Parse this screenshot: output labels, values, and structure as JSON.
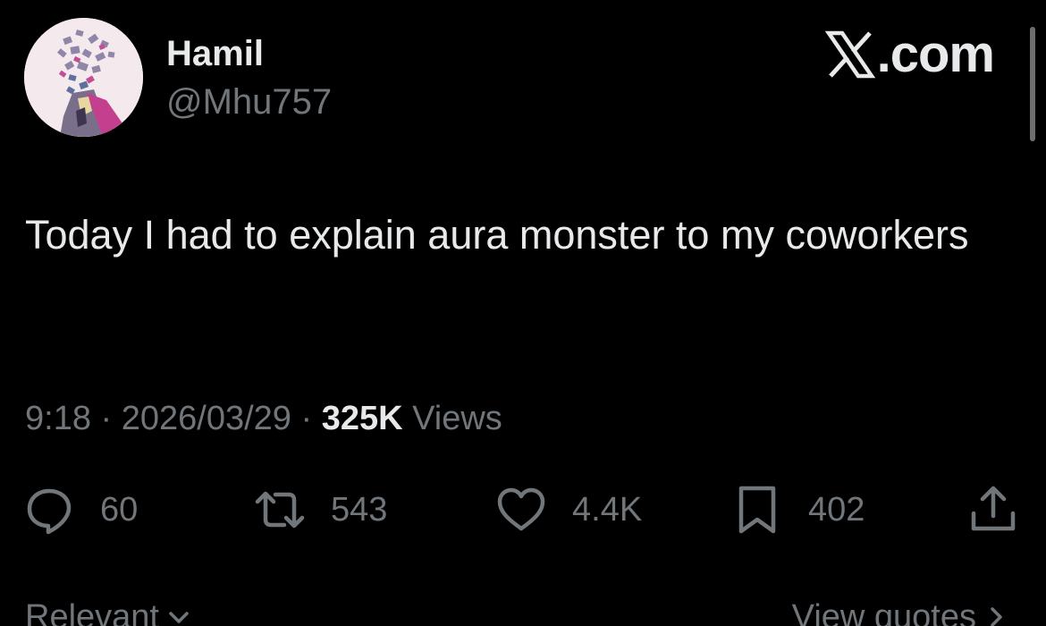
{
  "colors": {
    "background": "#000000",
    "primary_text": "#e7e9ea",
    "secondary_text": "#71767b"
  },
  "author": {
    "display_name": "Hamil",
    "handle": "@Mhu757",
    "avatar_icon": "avatar-illustration"
  },
  "brand": {
    "label": ".com",
    "icon": "x-logo-icon"
  },
  "post": {
    "text": "Today I had to explain aura monster to my coworkers"
  },
  "meta": {
    "time": "9:18",
    "separator": " · ",
    "date": "2026/03/29",
    "views_count": "325K",
    "views_label": " Views"
  },
  "actions": {
    "reply": {
      "icon": "reply-icon",
      "count": "60"
    },
    "repost": {
      "icon": "repost-icon",
      "count": "543"
    },
    "like": {
      "icon": "heart-icon",
      "count": "4.4K"
    },
    "bookmark": {
      "icon": "bookmark-icon",
      "count": "402"
    },
    "share": {
      "icon": "share-icon"
    }
  },
  "footer": {
    "sort_label": "Relevant",
    "quotes_label": "View quotes"
  }
}
